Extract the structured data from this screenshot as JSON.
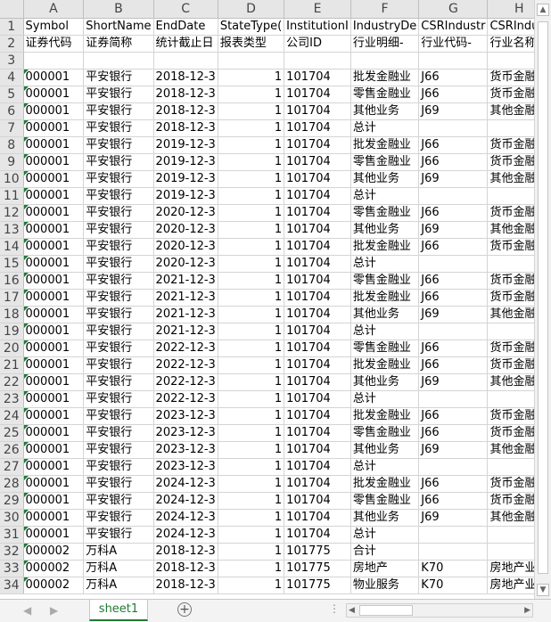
{
  "columns": [
    "A",
    "B",
    "C",
    "D",
    "E",
    "F",
    "G",
    "H"
  ],
  "colors": {
    "accent": "#1e7b34",
    "header_bg": "#e6e6e6",
    "grid_line": "#d4d4d4"
  },
  "rows": [
    {
      "n": "1",
      "c": [
        "Symbol",
        "ShortName",
        "EndDate",
        "StateType(",
        "InstitutionI",
        "IndustryDe",
        "CSRIndustr",
        "CSRIndus"
      ]
    },
    {
      "n": "2",
      "c": [
        "证券代码",
        "证券简称",
        "统计截止日",
        "报表类型",
        "公司ID",
        "行业明细-",
        "行业代码-",
        "行业名称"
      ]
    },
    {
      "n": "3",
      "c": [
        "",
        "",
        "",
        "",
        "",
        "",
        "",
        ""
      ]
    },
    {
      "n": "4",
      "c": [
        "000001",
        "平安银行",
        "2018-12-3",
        "1",
        "101704",
        "批发金融业",
        "J66",
        "货币金融"
      ]
    },
    {
      "n": "5",
      "c": [
        "000001",
        "平安银行",
        "2018-12-3",
        "1",
        "101704",
        "零售金融业",
        "J66",
        "货币金融"
      ]
    },
    {
      "n": "6",
      "c": [
        "000001",
        "平安银行",
        "2018-12-3",
        "1",
        "101704",
        "其他业务",
        "J69",
        "其他金融"
      ]
    },
    {
      "n": "7",
      "c": [
        "000001",
        "平安银行",
        "2018-12-3",
        "1",
        "101704",
        "总计",
        "",
        ""
      ]
    },
    {
      "n": "8",
      "c": [
        "000001",
        "平安银行",
        "2019-12-3",
        "1",
        "101704",
        "批发金融业",
        "J66",
        "货币金融"
      ]
    },
    {
      "n": "9",
      "c": [
        "000001",
        "平安银行",
        "2019-12-3",
        "1",
        "101704",
        "零售金融业",
        "J66",
        "货币金融"
      ]
    },
    {
      "n": "10",
      "c": [
        "000001",
        "平安银行",
        "2019-12-3",
        "1",
        "101704",
        "其他业务",
        "J69",
        "其他金融"
      ]
    },
    {
      "n": "11",
      "c": [
        "000001",
        "平安银行",
        "2019-12-3",
        "1",
        "101704",
        "总计",
        "",
        ""
      ]
    },
    {
      "n": "12",
      "c": [
        "000001",
        "平安银行",
        "2020-12-3",
        "1",
        "101704",
        "零售金融业",
        "J66",
        "货币金融"
      ]
    },
    {
      "n": "13",
      "c": [
        "000001",
        "平安银行",
        "2020-12-3",
        "1",
        "101704",
        "其他业务",
        "J69",
        "其他金融"
      ]
    },
    {
      "n": "14",
      "c": [
        "000001",
        "平安银行",
        "2020-12-3",
        "1",
        "101704",
        "批发金融业",
        "J66",
        "货币金融"
      ]
    },
    {
      "n": "15",
      "c": [
        "000001",
        "平安银行",
        "2020-12-3",
        "1",
        "101704",
        "总计",
        "",
        ""
      ]
    },
    {
      "n": "16",
      "c": [
        "000001",
        "平安银行",
        "2021-12-3",
        "1",
        "101704",
        "零售金融业",
        "J66",
        "货币金融"
      ]
    },
    {
      "n": "17",
      "c": [
        "000001",
        "平安银行",
        "2021-12-3",
        "1",
        "101704",
        "批发金融业",
        "J66",
        "货币金融"
      ]
    },
    {
      "n": "18",
      "c": [
        "000001",
        "平安银行",
        "2021-12-3",
        "1",
        "101704",
        "其他业务",
        "J69",
        "其他金融"
      ]
    },
    {
      "n": "19",
      "c": [
        "000001",
        "平安银行",
        "2021-12-3",
        "1",
        "101704",
        "总计",
        "",
        ""
      ]
    },
    {
      "n": "20",
      "c": [
        "000001",
        "平安银行",
        "2022-12-3",
        "1",
        "101704",
        "零售金融业",
        "J66",
        "货币金融"
      ]
    },
    {
      "n": "21",
      "c": [
        "000001",
        "平安银行",
        "2022-12-3",
        "1",
        "101704",
        "批发金融业",
        "J66",
        "货币金融"
      ]
    },
    {
      "n": "22",
      "c": [
        "000001",
        "平安银行",
        "2022-12-3",
        "1",
        "101704",
        "其他业务",
        "J69",
        "其他金融"
      ]
    },
    {
      "n": "23",
      "c": [
        "000001",
        "平安银行",
        "2022-12-3",
        "1",
        "101704",
        "总计",
        "",
        ""
      ]
    },
    {
      "n": "24",
      "c": [
        "000001",
        "平安银行",
        "2023-12-3",
        "1",
        "101704",
        "批发金融业",
        "J66",
        "货币金融"
      ]
    },
    {
      "n": "25",
      "c": [
        "000001",
        "平安银行",
        "2023-12-3",
        "1",
        "101704",
        "零售金融业",
        "J66",
        "货币金融"
      ]
    },
    {
      "n": "26",
      "c": [
        "000001",
        "平安银行",
        "2023-12-3",
        "1",
        "101704",
        "其他业务",
        "J69",
        "其他金融"
      ]
    },
    {
      "n": "27",
      "c": [
        "000001",
        "平安银行",
        "2023-12-3",
        "1",
        "101704",
        "总计",
        "",
        ""
      ]
    },
    {
      "n": "28",
      "c": [
        "000001",
        "平安银行",
        "2024-12-3",
        "1",
        "101704",
        "批发金融业",
        "J66",
        "货币金融"
      ]
    },
    {
      "n": "29",
      "c": [
        "000001",
        "平安银行",
        "2024-12-3",
        "1",
        "101704",
        "零售金融业",
        "J66",
        "货币金融"
      ]
    },
    {
      "n": "30",
      "c": [
        "000001",
        "平安银行",
        "2024-12-3",
        "1",
        "101704",
        "其他业务",
        "J69",
        "其他金融"
      ]
    },
    {
      "n": "31",
      "c": [
        "000001",
        "平安银行",
        "2024-12-3",
        "1",
        "101704",
        "总计",
        "",
        ""
      ]
    },
    {
      "n": "32",
      "c": [
        "000002",
        "万科A",
        "2018-12-3",
        "1",
        "101775",
        "合计",
        "",
        ""
      ]
    },
    {
      "n": "33",
      "c": [
        "000002",
        "万科A",
        "2018-12-3",
        "1",
        "101775",
        "房地产",
        "K70",
        "房地产业"
      ]
    },
    {
      "n": "34",
      "c": [
        "000002",
        "万科A",
        "2018-12-3",
        "1",
        "101775",
        "物业服务",
        "K70",
        "房地产业"
      ]
    }
  ],
  "sheet_tab": "sheet1",
  "icons": {
    "add_sheet": "plus-circle-icon",
    "prev": "chevron-left-icon",
    "next": "chevron-right-icon",
    "more": "ellipsis-icon"
  },
  "glyphs": {
    "prev": "◀",
    "next": "▶",
    "add": "+",
    "more": "⋮",
    "up": "▲",
    "down": "▼",
    "left": "◀",
    "right": "▶"
  }
}
